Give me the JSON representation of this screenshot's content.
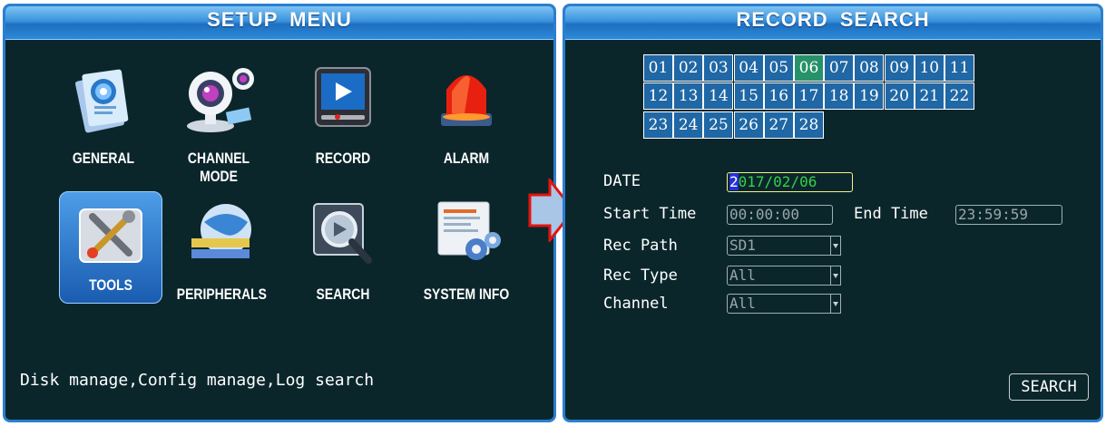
{
  "setup_menu": {
    "title": "SETUP  MENU",
    "items": [
      {
        "label": "GENERAL",
        "icon": "general-settings-icon"
      },
      {
        "label": "CHANNEL MODE",
        "icon": "webcam-icon"
      },
      {
        "label": "RECORD",
        "icon": "record-icon"
      },
      {
        "label": "ALARM",
        "icon": "alarm-light-icon"
      },
      {
        "label": "TOOLS",
        "icon": "tools-icon",
        "selected": true
      },
      {
        "label": "PERIPHERALS",
        "icon": "peripherals-icon"
      },
      {
        "label": "SEARCH",
        "icon": "search-icon"
      },
      {
        "label": "SYSTEM INFO",
        "icon": "system-info-icon"
      }
    ],
    "hint": "Disk manage,Config manage,Log search"
  },
  "record_search": {
    "title": "RECORD  SEARCH",
    "calendar": {
      "days": [
        "01",
        "02",
        "03",
        "04",
        "05",
        "06",
        "07",
        "08",
        "09",
        "10",
        "11",
        "12",
        "13",
        "14",
        "15",
        "16",
        "17",
        "18",
        "19",
        "20",
        "21",
        "22",
        "23",
        "24",
        "25",
        "26",
        "27",
        "28"
      ],
      "selected_day": "06"
    },
    "date_label": "DATE",
    "date_cursor": "2",
    "date_rest": "017/02/06",
    "start_time_label": "Start Time",
    "start_time": "00:00:00",
    "end_time_label": "End Time",
    "end_time": "23:59:59",
    "rec_path_label": "Rec Path",
    "rec_path": "SD1",
    "rec_type_label": "Rec Type",
    "rec_type": "All",
    "channel_label": "Channel",
    "channel": "All",
    "search_button": "SEARCH"
  },
  "colors": {
    "panel_bg": "#0b262b",
    "panel_border": "#2a7fd0",
    "day_cell": "#1f67a5",
    "day_selected": "#27926a",
    "date_text": "#35d04a",
    "arrow_red": "#e3140e"
  }
}
